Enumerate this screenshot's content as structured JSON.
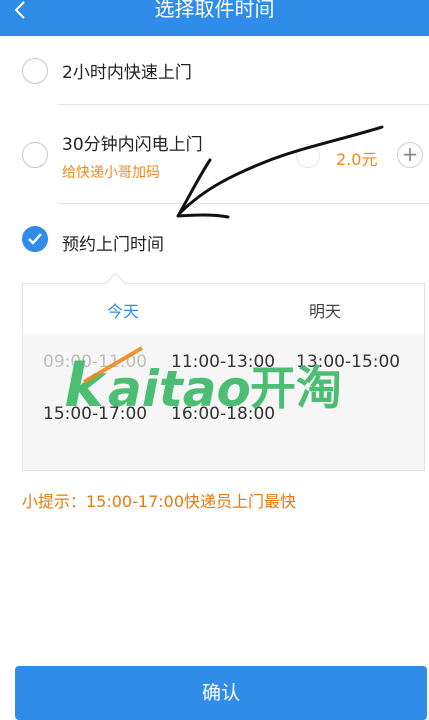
{
  "header": {
    "title": "选择取件时间",
    "back_icon": "chevron-left-icon",
    "background": "#2f8ce8"
  },
  "options": [
    {
      "label": "2小时内快速上门",
      "checked": false
    },
    {
      "label": "30分钟内闪电上门",
      "sub": "给快递小哥加码",
      "price": "2.0元",
      "checked": false
    },
    {
      "label": "预约上门时间",
      "checked": true
    }
  ],
  "schedule": {
    "tabs": [
      {
        "label": "今天",
        "active": true
      },
      {
        "label": "明天",
        "active": false
      }
    ],
    "slots": [
      {
        "label": "09:00-11:00",
        "available": false
      },
      {
        "label": "11:00-13:00",
        "available": true
      },
      {
        "label": "13:00-15:00",
        "available": true
      },
      {
        "label": "15:00-17:00",
        "available": true
      },
      {
        "label": "16:00-18:00",
        "available": true
      }
    ]
  },
  "tip": "小提示：15:00-17:00快递员上门最快",
  "confirm_label": "确认",
  "watermark": {
    "text_latin": "kaitao",
    "text_cjk": "开淘",
    "color": "#3dba68",
    "accent": "#f08a1c"
  },
  "colors": {
    "primary": "#2f8ce8",
    "accent_orange": "#f08a1c"
  }
}
